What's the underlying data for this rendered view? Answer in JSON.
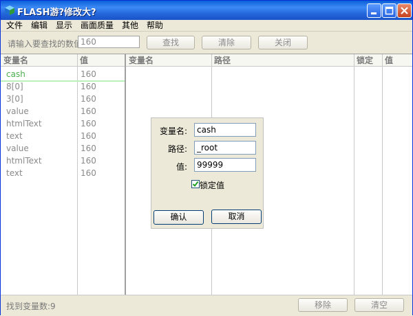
{
  "window": {
    "title": "FLASH游?修改大?"
  },
  "menu": {
    "items": [
      {
        "label": "文件"
      },
      {
        "label": "编辑"
      },
      {
        "label": "显示"
      },
      {
        "label": "画面质量"
      },
      {
        "label": "其他"
      },
      {
        "label": "帮助"
      }
    ]
  },
  "search": {
    "label": "请输入要查找的数值",
    "value": "160",
    "find_label": "查找",
    "clear_label": "清除",
    "close_label": "关闭"
  },
  "left_table": {
    "headers": [
      "变量名",
      "值"
    ],
    "rows": [
      {
        "name": "cash",
        "value": "160"
      },
      {
        "name": "8[0]",
        "value": "160"
      },
      {
        "name": "3[0]",
        "value": "160"
      },
      {
        "name": "value",
        "value": "160"
      },
      {
        "name": "htmlText",
        "value": "160"
      },
      {
        "name": "text",
        "value": "160"
      },
      {
        "name": "value",
        "value": "160"
      },
      {
        "name": "htmlText",
        "value": "160"
      },
      {
        "name": "text",
        "value": "160"
      }
    ]
  },
  "right_table": {
    "headers": [
      "变量名",
      "路径",
      "锁定",
      "值"
    ]
  },
  "status": {
    "found_text": "找到变量数:9",
    "remove_label": "移除",
    "clear_label": "清空"
  },
  "dialog": {
    "name_label": "变量名:",
    "name_value": "cash",
    "path_label": "路径:",
    "path_value": "_root",
    "value_label": "值:",
    "value_value": "99999",
    "lock_label": "锁定值",
    "lock_checked": true,
    "ok_label": "确认",
    "cancel_label": "取消"
  },
  "colors": {
    "titlebar": "#2364d9",
    "face": "#ece9d8",
    "selection_underline": "#b9f2b9"
  }
}
